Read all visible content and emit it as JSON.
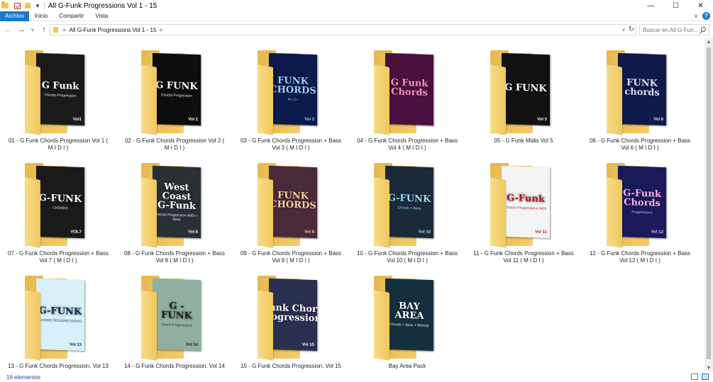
{
  "window": {
    "title": "All G-Funk Progressions Vol 1 - 15",
    "controls": {
      "minimize": "—",
      "maximize": "☐",
      "close": "✕"
    }
  },
  "ribbon": {
    "tabs": [
      "Archivo",
      "Inicio",
      "Compartir",
      "Vista"
    ],
    "active_tab": "Archivo",
    "help": "?"
  },
  "navigation": {
    "back": "←",
    "forward": "→",
    "recent": "v",
    "up": "↑",
    "path_separator": ">",
    "path": "All G-Funk Progressions Vol 1 - 15",
    "refresh": "↻",
    "search_placeholder": "Buscar en All G-Fun..."
  },
  "colors": {
    "accent": "#1979ca",
    "folder": "#f3c84c"
  },
  "items": [
    {
      "name_line1": "01 - G Funk Chords Progression Vol 1 (",
      "name_line2": "M I D I )",
      "cover_title": "G Funk",
      "cover_sub": "Chords Progression",
      "cover_vol": "Vol1",
      "cover_bg": "#1a1a1a",
      "cover_fg": "#ffffff"
    },
    {
      "name_line1": "02 - G Funk Chords Progression Vol 2 (",
      "name_line2": "M I D I )",
      "cover_title": "G FUNK",
      "cover_sub": "Chords Progression",
      "cover_vol": "Vol 2",
      "cover_bg": "#0d0d0d",
      "cover_fg": "#ffffff"
    },
    {
      "name_line1": "03 - G Funk Chords Progression + Bass",
      "name_line2": "Vol 3 ( M I D I )",
      "cover_title": "FUNK CHORDS",
      "cover_sub": "M I D I",
      "cover_vol": "Vol 3",
      "cover_bg": "#0b1a4a",
      "cover_fg": "#9fd0ff"
    },
    {
      "name_line1": "04 - G Funk Chords Progression + Bass",
      "name_line2": "Vol 4 ( M I D I )",
      "cover_title": "G Funk Chords",
      "cover_sub": "",
      "cover_vol": "",
      "cover_bg": "#4a1040",
      "cover_fg": "#ff8fd0"
    },
    {
      "name_line1": "05 - G Funk Midis Vol 5",
      "name_line2": "",
      "cover_title": "G FUNK",
      "cover_sub": "",
      "cover_vol": "Vol 5",
      "cover_bg": "#111111",
      "cover_fg": "#ffffff"
    },
    {
      "name_line1": "06 - G Funk Chords Progression + Bass",
      "name_line2": "Vol 6 ( M I D I )",
      "cover_title": "FUNK chords",
      "cover_sub": "",
      "cover_vol": "Vol 6",
      "cover_bg": "#101a4a",
      "cover_fg": "#d8e4ff"
    },
    {
      "name_line1": "07 - G Funk Chords Progression + Bass",
      "name_line2": "Vol 7 ( M I D I )",
      "cover_title": "G-FUNK",
      "cover_sub": "CHORDS",
      "cover_vol": "VOL7",
      "cover_bg": "#1a1a1a",
      "cover_fg": "#ffffff"
    },
    {
      "name_line1": "08 - G Funk Chords Progression + Bass",
      "name_line2": "Vol 8 ( M I D I )",
      "cover_title": "West Coast G-Funk",
      "cover_sub": "Chords Progression MIDI + Bass",
      "cover_vol": "Vol 8",
      "cover_bg": "#2a2f36",
      "cover_fg": "#ffffff"
    },
    {
      "name_line1": "09 - G Funk Chords Progression + Bass",
      "name_line2": "Vol 9 ( M I D I )",
      "cover_title": "FUNK CHORDS",
      "cover_sub": "",
      "cover_vol": "Vol 9",
      "cover_bg": "#4a2a3a",
      "cover_fg": "#ffd0a0"
    },
    {
      "name_line1": "10 - G Funk Chords Progression + Bass",
      "name_line2": "Vol 10 ( M I D I )",
      "cover_title": "G-FUNK",
      "cover_sub": "Chords + Bass",
      "cover_vol": "Vol 10",
      "cover_bg": "#1a2a3a",
      "cover_fg": "#9fe0ff"
    },
    {
      "name_line1": "11 - G Funk Chords Progression + Bass",
      "name_line2": "Vol 11 ( M I D I )",
      "cover_title": "G-Funk",
      "cover_sub": "Chords Progressions MIDI",
      "cover_vol": "Vol 11",
      "cover_bg": "#f4f4f4",
      "cover_fg": "#b01818"
    },
    {
      "name_line1": "12 - G Funk Chords Progression + Bass",
      "name_line2": "Vol 12 ( M I D I )",
      "cover_title": "G-Funk Chords",
      "cover_sub": "Progressions",
      "cover_vol": "Vol 12",
      "cover_bg": "#1a1a5a",
      "cover_fg": "#ffb0ff"
    },
    {
      "name_line1": "13 - G Funk Chords Progression. Vol 13",
      "name_line2": "",
      "cover_title": "G-FUNK",
      "cover_sub": "CHORD PROGRESSIONS",
      "cover_vol": "Vol 13",
      "cover_bg": "#d8f0f8",
      "cover_fg": "#0a2a4a"
    },
    {
      "name_line1": "14 - G Funk Chords Progression. Vol 14",
      "name_line2": "",
      "cover_title": "G - FUNK",
      "cover_sub": "Chord Progressions",
      "cover_vol": "Vol 14",
      "cover_bg": "#8fb0a0",
      "cover_fg": "#1a1a1a"
    },
    {
      "name_line1": "15 - G Funk Chords Progression. Vol 15",
      "name_line2": "",
      "cover_title": "Funk Chord Progressions",
      "cover_sub": "",
      "cover_vol": "Vol 15",
      "cover_bg": "#2a3050",
      "cover_fg": "#ffffff"
    },
    {
      "name_line1": "Bay Area Pack",
      "name_line2": "",
      "cover_title": "BAY AREA",
      "cover_sub": "Chords + Bass + Melody",
      "cover_vol": "",
      "cover_bg": "#143040",
      "cover_fg": "#ffffff"
    }
  ],
  "status": {
    "item_count": "16 elementos"
  }
}
